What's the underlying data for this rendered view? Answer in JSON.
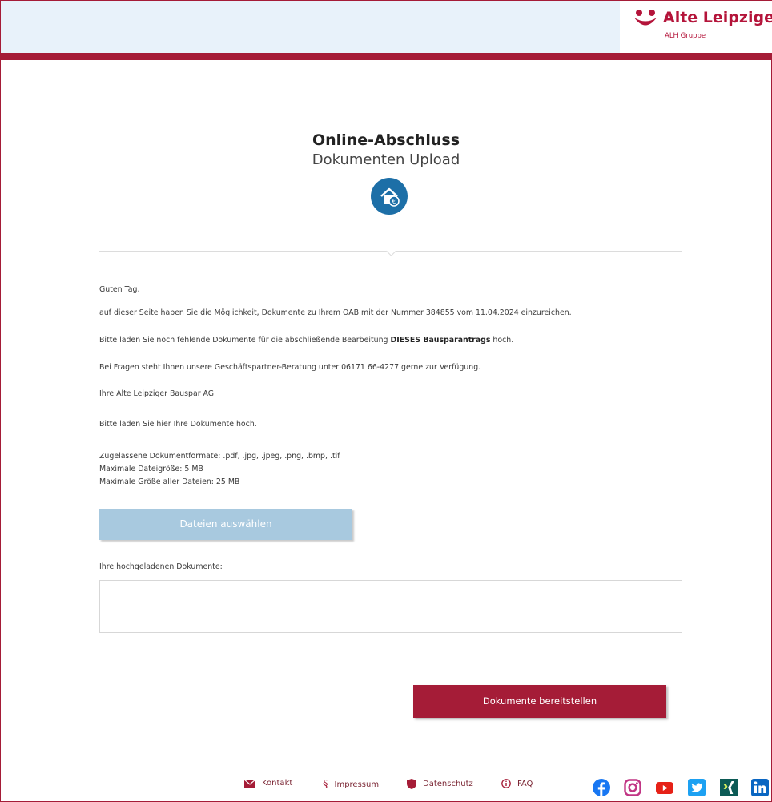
{
  "brand": {
    "name": "Alte Leipziger",
    "group": "ALH Gruppe",
    "color": "#b4143a"
  },
  "header": {
    "title": "Online-Abschluss",
    "subtitle": "Dokumenten Upload",
    "icon": "house-euro-icon"
  },
  "content": {
    "greeting": "Guten Tag,",
    "line1": "auf dieser Seite haben Sie die Möglichkeit, Dokumente zu Ihrem OAB mit der Nummer 384855 vom 11.04.2024 einzureichen.",
    "line2_pre": "Bitte laden Sie noch fehlende Dokumente für die abschließende Bearbeitung ",
    "line2_bold": "DIESES Bausparantrags",
    "line2_post": " hoch.",
    "line3": "Bei Fragen steht Ihnen unsere Geschäftspartner-Beratung unter 06171 66-4277 gerne zur Verfügung.",
    "signature": "Ihre Alte Leipziger Bauspar AG",
    "upload_prompt": "Bitte laden Sie hier Ihre Dokumente hoch.",
    "formats": "Zugelassene Dokumentformate: .pdf, .jpg, .jpeg, .png, .bmp, .tif",
    "max_file": "Maximale Dateigröße: 5 MB",
    "max_total": "Maximale Größe aller Dateien: 25 MB",
    "select_button": "Dateien auswählen",
    "uploaded_label": "Ihre hochgeladenen Dokumente:",
    "submit_button": "Dokumente bereitstellen"
  },
  "footer": {
    "links": [
      {
        "label": "Kontakt",
        "icon": "mail-icon"
      },
      {
        "label": "Impressum",
        "icon": "paragraph-icon"
      },
      {
        "label": "Datenschutz",
        "icon": "shield-icon"
      },
      {
        "label": "FAQ",
        "icon": "info-icon"
      }
    ],
    "social": [
      "facebook-icon",
      "instagram-icon",
      "youtube-icon",
      "twitter-icon",
      "xing-icon",
      "linkedin-icon"
    ]
  },
  "colors": {
    "accent": "#a51c37",
    "header_bg": "#e8f2fa",
    "select_button_bg": "#a8c9df",
    "icon_blue": "#1d6fa7"
  }
}
